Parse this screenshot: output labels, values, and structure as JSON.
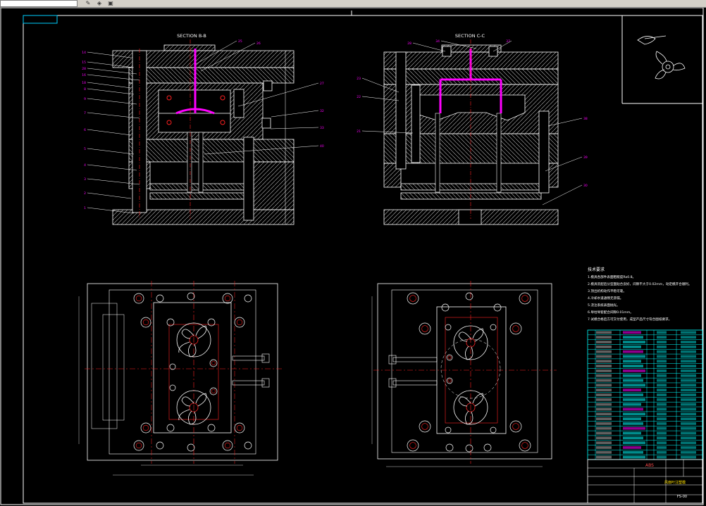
{
  "sections": {
    "left_title": "SECTION B-B",
    "right_title": "SECTION C-C"
  },
  "left_callouts": [
    "14",
    "15",
    "28",
    "16",
    "18",
    "8",
    "9",
    "7",
    "6",
    "5",
    "4",
    "3",
    "2",
    "1"
  ],
  "left_right_callouts": [
    "25",
    "26",
    "27",
    "32",
    "33",
    "40"
  ],
  "right_callouts": [
    "28",
    "34",
    "37",
    "23",
    "22",
    "21"
  ],
  "right_right_callouts": [
    "38",
    "39",
    "30"
  ],
  "tech_notes": {
    "title": "技术要求",
    "lines": [
      "1.模具各部件表面粗糙度Ra0.8。",
      "2.模具装配后分型面贴合良好，间隙不大于0.02mm，动定模开合顺利。",
      "3.顶出机构动作平稳可靠。",
      "4.冷却水道通畅无渗漏。",
      "5.浇注系统表面抛光。",
      "6.导柱导套配合间隙0.01mm。",
      "7.试模合格后方可交付使用，成型产品尺寸符合图纸要求。"
    ]
  },
  "title_block": {
    "material": "ABS",
    "drawing_name": "风扇叶注塑模",
    "drawing_no": "FS-00"
  },
  "colors": {
    "outline": "#ffffff",
    "geometry": "#e8e8e8",
    "centerline": "#ff2020",
    "cooling": "#ff00ff",
    "dimension": "#f0f0f0",
    "table": "#00ffff",
    "label": "#ffffff"
  }
}
